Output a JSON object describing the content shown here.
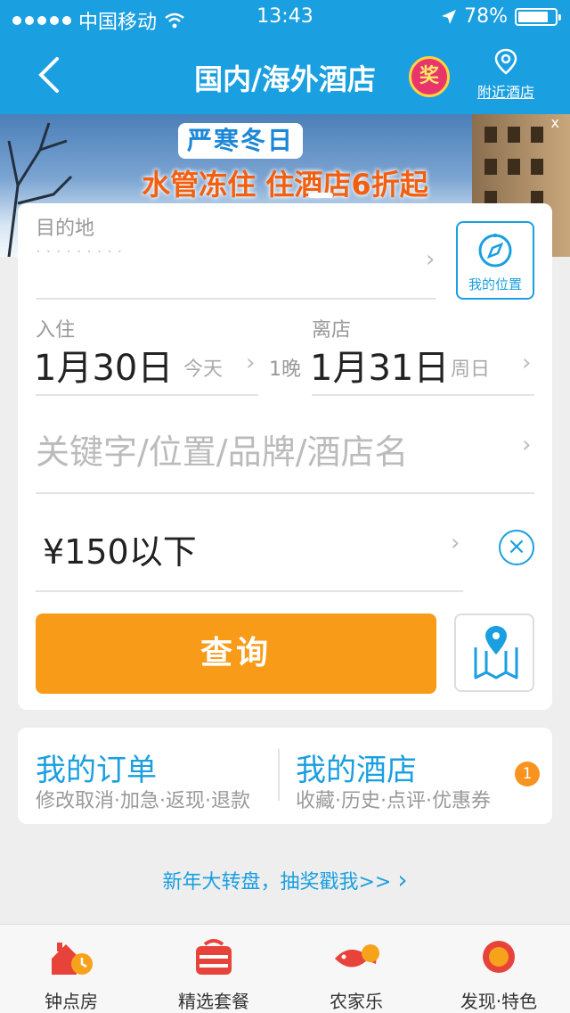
{
  "status_bar": {
    "carrier": "中国移动",
    "time": "13:43",
    "battery": "78%",
    "battery_level": 0.78
  },
  "nav": {
    "title": "国内/海外酒店",
    "prize_badge": "奖",
    "nearby_label": "附近酒店"
  },
  "banner": {
    "headline": "严寒冬日",
    "slogan": "水管冻住  住酒店6折起",
    "close": "x"
  },
  "search": {
    "destination_label": "目的地",
    "my_location_label": "我的位置",
    "checkin_label": "入住",
    "checkin_date": "1月30日",
    "checkin_day": "今天",
    "nights": "1晚",
    "checkout_label": "离店",
    "checkout_date": "1月31日",
    "checkout_day": "周日",
    "keyword_placeholder": "关键字/位置/品牌/酒店名",
    "price": "¥150以下",
    "search_button": "查询"
  },
  "orders": {
    "my_orders_title": "我的订单",
    "my_orders_sub": "修改取消·加急·返现·退款",
    "my_hotels_title": "我的酒店",
    "my_hotels_sub": "收藏·历史·点评·优惠券",
    "badge_count": "1"
  },
  "promo_link": "新年大转盘，抽奖戳我>> ",
  "tabs": [
    {
      "label": "钟点房",
      "icon": "hourly-room-icon"
    },
    {
      "label": "精选套餐",
      "icon": "package-icon"
    },
    {
      "label": "农家乐",
      "icon": "farm-stay-icon"
    },
    {
      "label": "发现·特色",
      "icon": "discover-icon"
    }
  ],
  "colors": {
    "brand_blue": "#1a9fe0",
    "search_orange": "#f89b19",
    "badge_orange": "#f7931e"
  }
}
